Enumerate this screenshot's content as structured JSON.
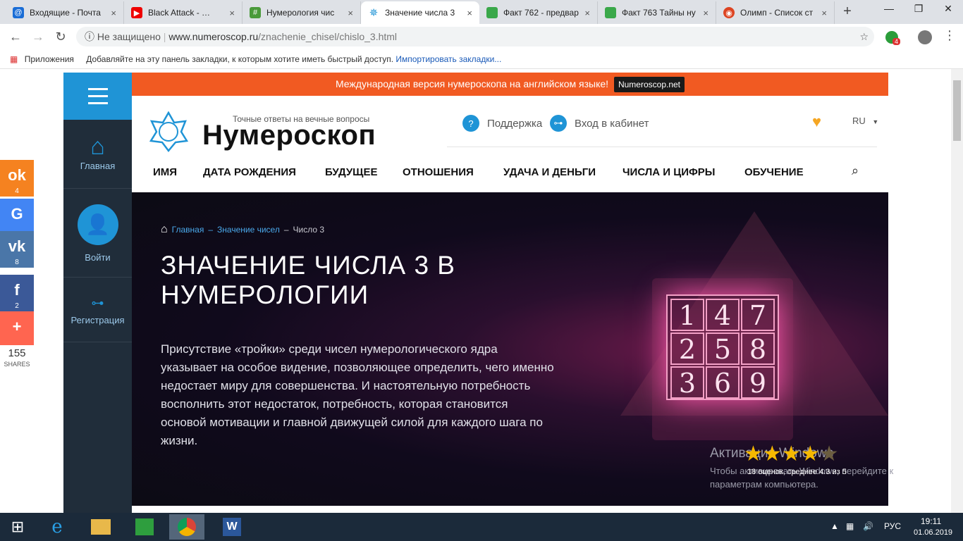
{
  "browser": {
    "tabs": [
      {
        "title": "Входящие - Почта",
        "fav": "@",
        "color": "#1a6dd6"
      },
      {
        "title": "Black Attack - …",
        "fav": "▶",
        "color": "#e00"
      },
      {
        "title": "Нумерология чис",
        "fav": "#",
        "color": "#4a9a3a"
      },
      {
        "title": "Значение числа 3",
        "fav": "✵",
        "color": "#fff"
      },
      {
        "title": "Факт 762 - предвар",
        "fav": "",
        "color": "#3aa84a"
      },
      {
        "title": "Факт 763 Тайны ну",
        "fav": "",
        "color": "#3aa84a"
      },
      {
        "title": "Олимп - Список ст",
        "fav": "◉",
        "color": "#d42"
      }
    ],
    "new_tab": "+",
    "url_prefix": "Не защищено",
    "url_host": "www.numeroscop.ru",
    "url_path": "/znachenie_chisel/chislo_3.html",
    "ext_badge": "4",
    "bookmarks_apps": "Приложения",
    "bookmarks_hint": "Добавляйте на эту панель закладки, к которым хотите иметь быстрый доступ.",
    "bookmarks_import": "Импортировать закладки..."
  },
  "banner": {
    "text": "Международная версия нумероскопа на английском языке!",
    "badge": "Numeroscop.net"
  },
  "sidebar": {
    "home": "Главная",
    "login": "Войти",
    "register": "Регистрация"
  },
  "header": {
    "tagline": "Точные ответы на вечные вопросы",
    "logo": "Нумероскоп",
    "support": "Поддержка",
    "cabinet": "Вход в кабинет",
    "lang": "RU"
  },
  "menu": [
    "ИМЯ",
    "ДАТА РОЖДЕНИЯ",
    "БУДУЩЕЕ",
    "ОТНОШЕНИЯ",
    "УДАЧА И ДЕНЬГИ",
    "ЧИСЛА И ЦИФРЫ",
    "ОБУЧЕНИЕ"
  ],
  "breadcrumb": {
    "home": "Главная",
    "sep": "–",
    "section": "Значение чисел",
    "current": "Число 3"
  },
  "hero": {
    "title": "ЗНАЧЕНИЕ ЧИСЛА 3 В НУМЕРОЛОГИИ",
    "lead": "Присутствие «тройки» среди чисел нумерологического ядра указывает на особое видение, позволяющее определить, чего именно недостает миру для совершенства. И настоятельную потребность восполнить этот недостаток, потребность, которая становится основой мотивации и главной движущей силой для каждого шага по жизни.",
    "grid": [
      "1",
      "4",
      "7",
      "2",
      "5",
      "8",
      "3",
      "6",
      "9"
    ]
  },
  "rating": {
    "text": "18 оценок, среднее 4.3 из 5",
    "value": 4.3,
    "max": 5
  },
  "windows_notice": {
    "line1": "Активация Windows",
    "line2": "Чтобы активировать Windows, перейдите к параметрам компьютера."
  },
  "shares": {
    "ok": "4",
    "vk": "8",
    "fb": "2",
    "total": "155",
    "label": "SHARES"
  },
  "taskbar": {
    "lang": "РУС",
    "time": "19:11",
    "date": "01.06.2019"
  }
}
